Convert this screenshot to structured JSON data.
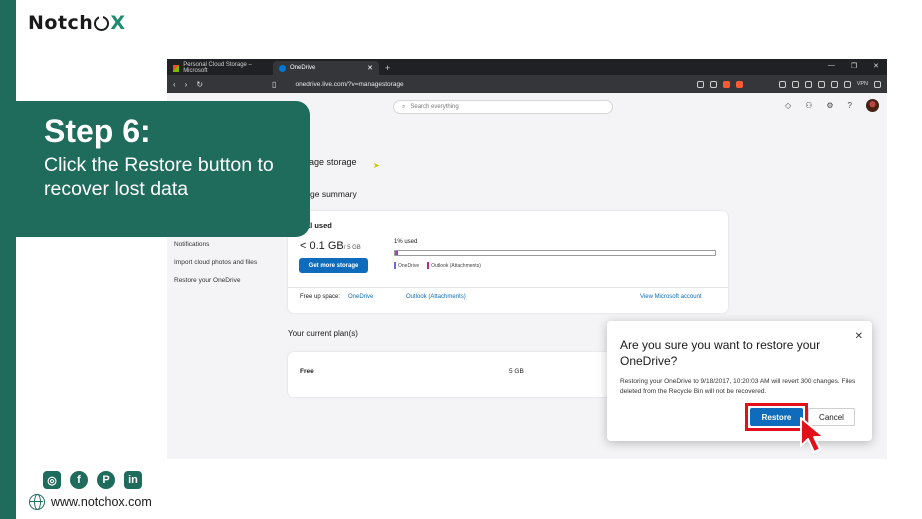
{
  "brand": {
    "pre": "Notch",
    "post": "X"
  },
  "step": {
    "title": "Step 6:",
    "description": "Click the Restore button to recover lost data"
  },
  "footer": {
    "website": "www.notchox.com",
    "social_icons": [
      "instagram-icon",
      "facebook-icon",
      "pinterest-icon",
      "linkedin-icon"
    ]
  },
  "browser": {
    "tabs": [
      {
        "label": "Personal Cloud Storage – Microsoft",
        "active": false
      },
      {
        "label": "OneDrive",
        "active": true
      }
    ],
    "url": "onedrive.live.com/?v=managestorage",
    "vpn_label": "VPN"
  },
  "onedrive": {
    "search_placeholder": "Search everything",
    "page_heading": "age storage",
    "summary_heading": "ge summary",
    "sidebar_links": [
      "Notifications",
      "Import cloud photos and files",
      "Restore your OneDrive"
    ],
    "summary": {
      "total_used_label": "al used",
      "used_amount": "< 0.1 GB",
      "used_quota": "/ 5 GB",
      "get_more_label": "Get more storage",
      "percent_used_label": "1% used",
      "percent_used": 1,
      "legend": [
        {
          "label": "OneDrive",
          "color": "#6b6bd6"
        },
        {
          "label": "Outlook (Attachments)",
          "color": "#c8228c"
        }
      ],
      "free_up_label": "Free up space:",
      "free_up_links": [
        "OneDrive",
        "Outlook (Attachments)"
      ],
      "view_account_label": "View Microsoft account"
    },
    "plans": {
      "title": "Your current plan(s)",
      "rows": [
        {
          "name": "Free",
          "size": "5 GB"
        }
      ]
    },
    "dialog": {
      "title": "Are you sure you want to restore your OneDrive?",
      "body": "Restoring your OneDrive to 9/18/2017, 10:20:03 AM will revert 300 changes. Files deleted from the Recycle Bin will not be recovered.",
      "restore_label": "Restore",
      "cancel_label": "Cancel"
    }
  },
  "colors": {
    "brand_green": "#1f6b5c",
    "accent_blue": "#0f6cbd",
    "highlight_red": "#e30f1b"
  }
}
